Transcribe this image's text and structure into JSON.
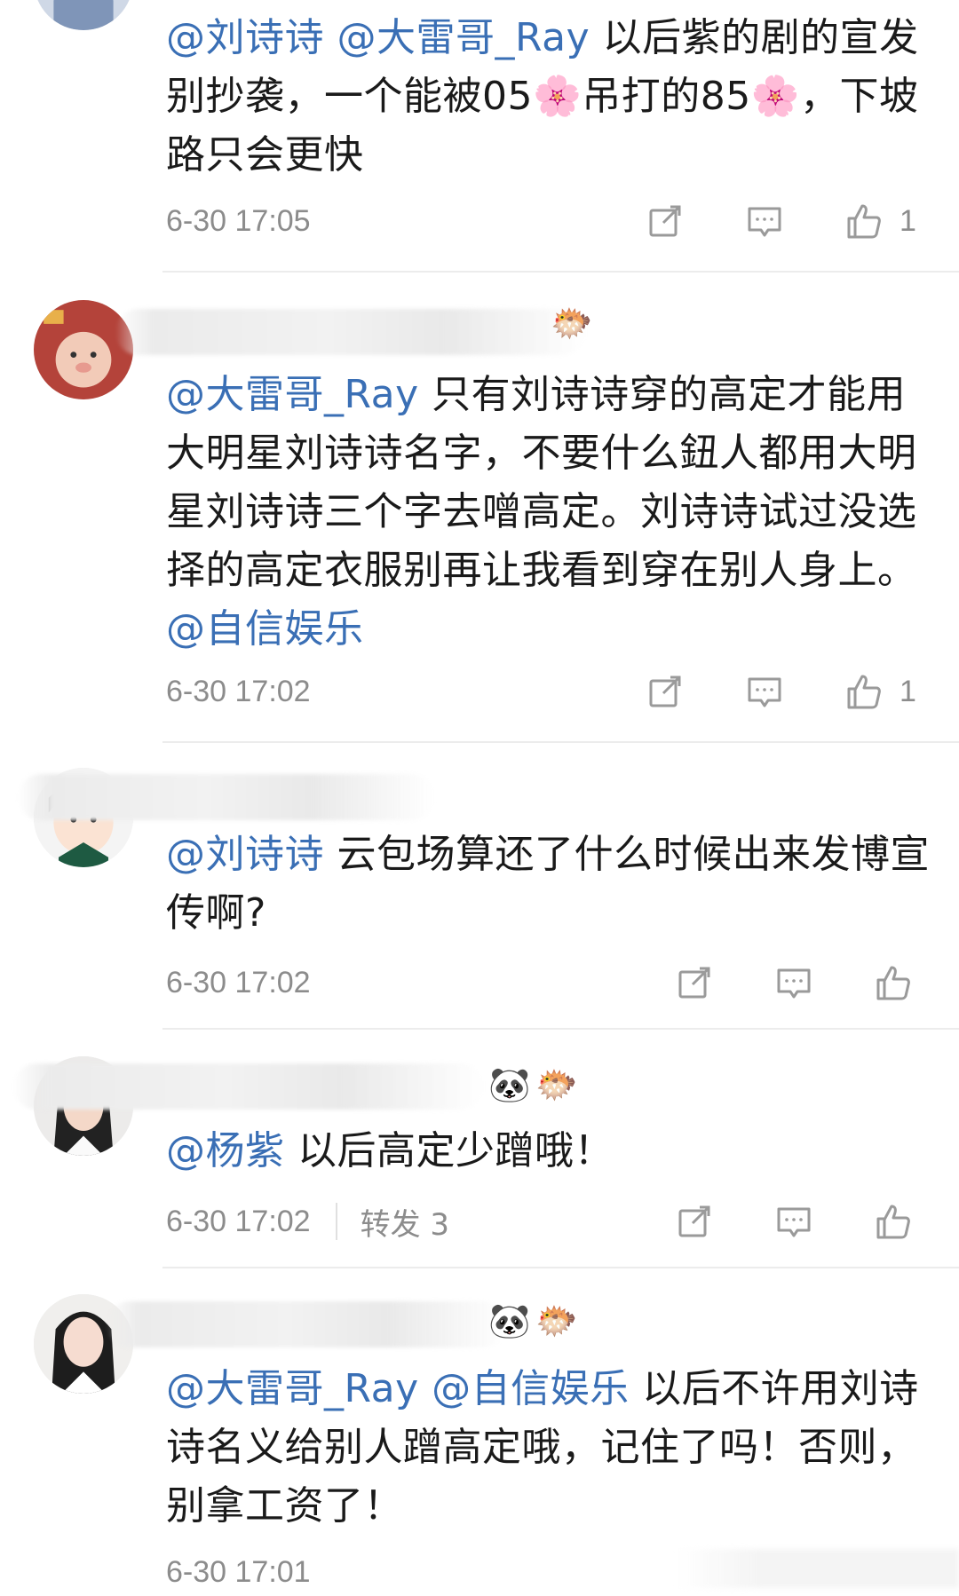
{
  "comments": [
    {
      "segments": [
        {
          "text": "@刘诗诗",
          "mention": true
        },
        {
          "text": " ",
          "mention": false
        },
        {
          "text": "@大雷哥_Ray",
          "mention": true
        },
        {
          "text": " 以后紫的剧的宣发别抄袭，一个能被05🌸吊打的85🌸，下坡路只会更快",
          "mention": false
        }
      ],
      "timestamp": "6-30 17:05",
      "likes": "1",
      "badges": []
    },
    {
      "segments": [
        {
          "text": "@大雷哥_Ray",
          "mention": true
        },
        {
          "text": " 只有刘诗诗穿的高定才能用大明星刘诗诗名字，不要什么鈕人都用大明星刘诗诗三个字去噌高定。刘诗诗试过没选择的高定衣服别再让我看到穿在别人身上。",
          "mention": false
        },
        {
          "text": "@自信娱乐",
          "mention": true
        }
      ],
      "timestamp": "6-30 17:02",
      "likes": "1",
      "badges": [
        "🐡"
      ]
    },
    {
      "segments": [
        {
          "text": "@刘诗诗",
          "mention": true
        },
        {
          "text": " 云包场算还了什么时候出来发博宣传啊?",
          "mention": false
        }
      ],
      "timestamp": "6-30 17:02",
      "likes": "",
      "badges": []
    },
    {
      "segments": [
        {
          "text": "@杨紫",
          "mention": true
        },
        {
          "text": " 以后高定少蹭哦！",
          "mention": false
        }
      ],
      "timestamp": "6-30 17:02",
      "reposts": "转发 3",
      "likes": "",
      "badges": [
        "🐼",
        "🐡"
      ]
    },
    {
      "segments": [
        {
          "text": "@大雷哥_Ray",
          "mention": true
        },
        {
          "text": " ",
          "mention": false
        },
        {
          "text": "@自信娱乐",
          "mention": true
        },
        {
          "text": " 以后不许用刘诗诗名义给别人蹭高定哦，记住了吗！否则，别拿工资了！",
          "mention": false
        }
      ],
      "timestamp": "6-30 17:01",
      "likes": "",
      "badges": [
        "🐼",
        "🐡"
      ]
    }
  ],
  "icons": {
    "repost": "share-icon",
    "comment": "comment-icon",
    "like": "thumbs-up-icon"
  },
  "colors": {
    "mention": "#3a6fb5",
    "text": "#1a1a1a",
    "meta": "#8c8c8c",
    "icon": "#9a9a9a"
  }
}
